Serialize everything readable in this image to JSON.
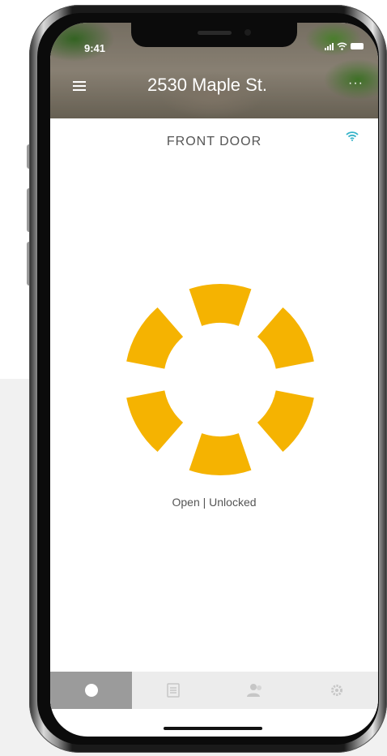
{
  "status_bar": {
    "time": "9:41"
  },
  "header": {
    "address": "2530 Maple St.",
    "more_label": "···"
  },
  "device": {
    "name": "FRONT DOOR"
  },
  "lock": {
    "status": "Open | Unlocked",
    "color": "#F5B301",
    "segments": 6
  },
  "tabs": [
    {
      "name": "lock-tab-icon",
      "active": true
    },
    {
      "name": "history-tab-icon",
      "active": false
    },
    {
      "name": "users-tab-icon",
      "active": false
    },
    {
      "name": "settings-tab-icon",
      "active": false
    }
  ],
  "colors": {
    "accent": "#F5B301",
    "wifi": "#36B3C9",
    "tab_active": "#9B9B9B"
  }
}
